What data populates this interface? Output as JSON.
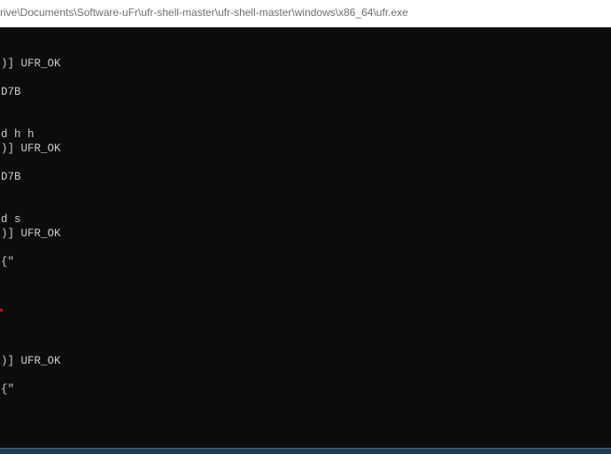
{
  "window": {
    "title": "rive\\Documents\\Software-uFr\\ufr-shell-master\\ufr-shell-master\\windows\\x86_64\\ufr.exe"
  },
  "console": {
    "lines": [
      ")] UFR_OK",
      "D7B",
      "d h h",
      ")] UFR_OK",
      "D7B",
      "d s",
      ")] UFR_OK",
      "{\"",
      ")] UFR_OK",
      "{\""
    ]
  },
  "colors": {
    "console_background": "#0c0c0c",
    "console_text": "#cccccc",
    "marker": "#c50f1f"
  }
}
